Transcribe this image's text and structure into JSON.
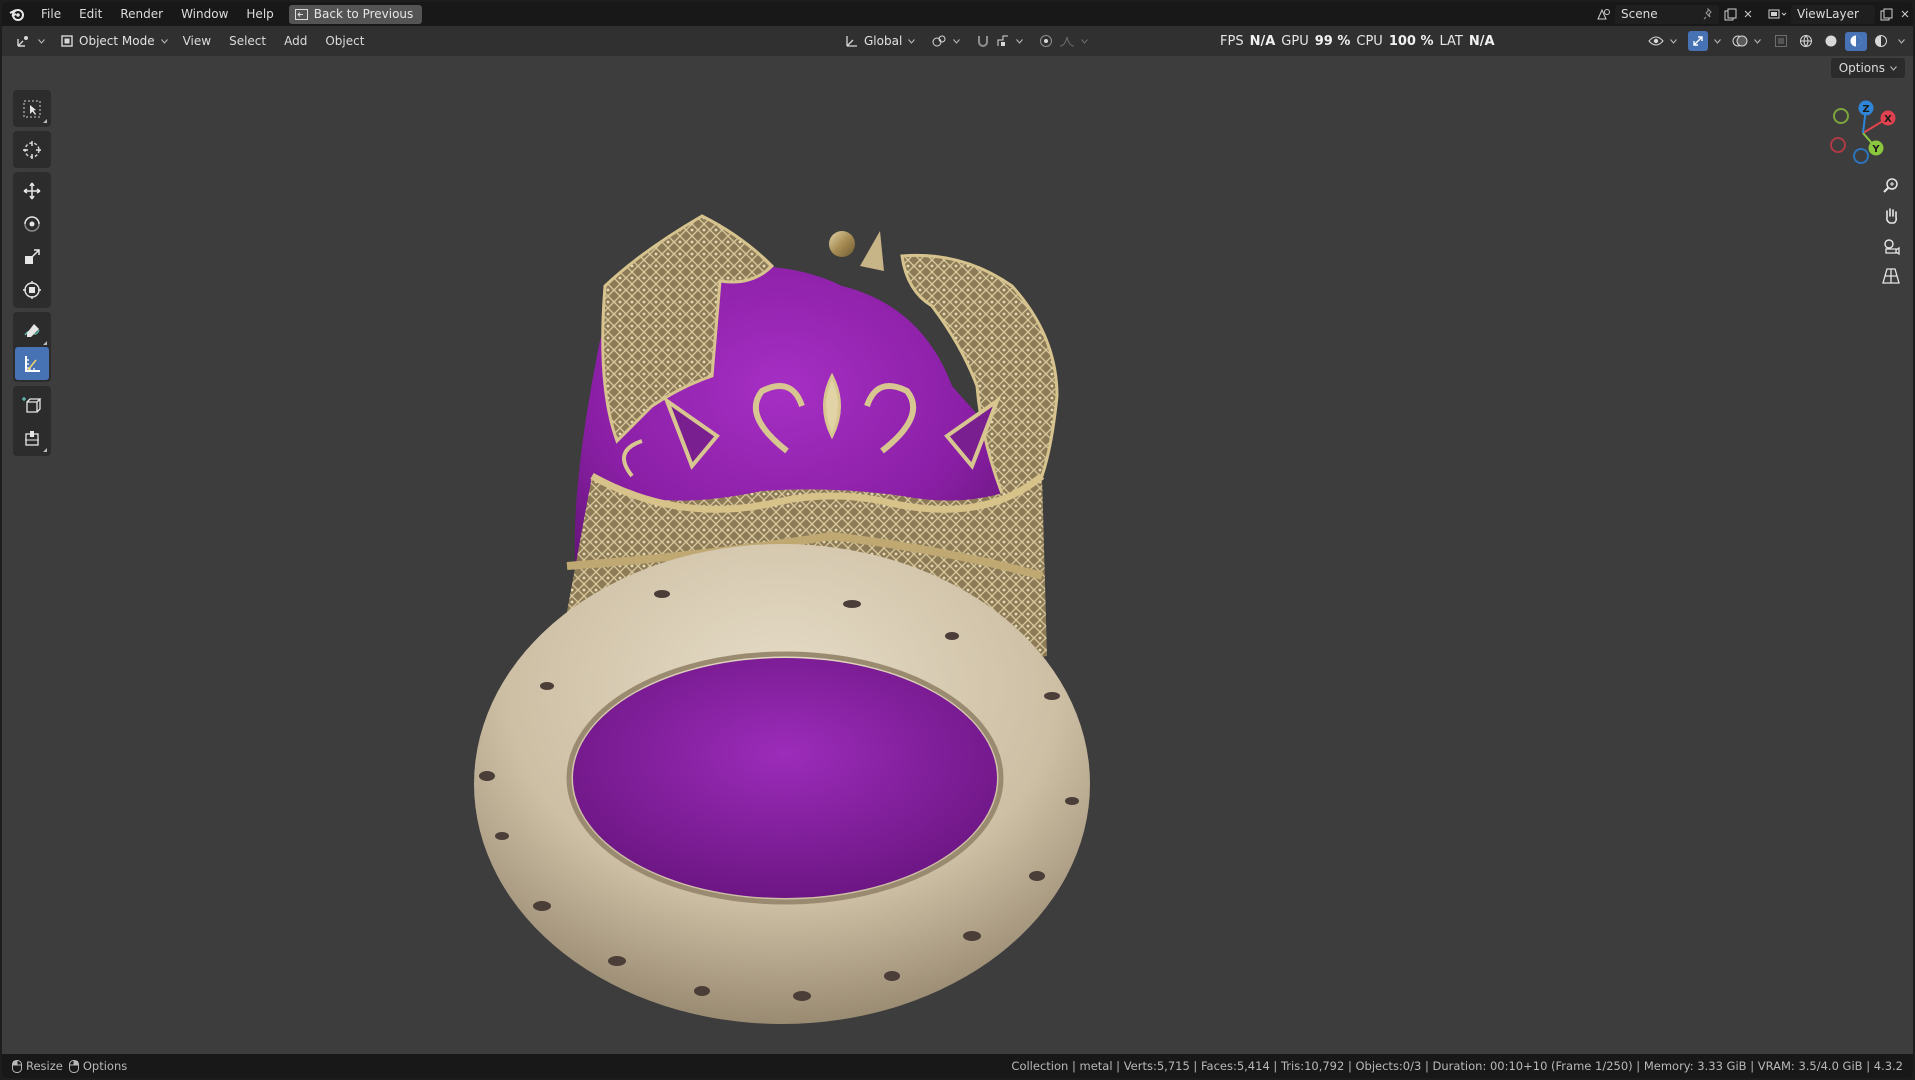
{
  "menu": {
    "items": [
      "File",
      "Edit",
      "Render",
      "Window",
      "Help"
    ],
    "back_button": "Back to Previous"
  },
  "topbar_right": {
    "scene_name": "Scene",
    "view_layer": "ViewLayer"
  },
  "viewport_header": {
    "mode": "Object Mode",
    "menus": [
      "View",
      "Select",
      "Add",
      "Object"
    ],
    "orientation": "Global",
    "options": "Options"
  },
  "stats": {
    "fps_label": "FPS",
    "fps_value": "N/A",
    "gpu_label": "GPU",
    "gpu_value": "99 %",
    "cpu_label": "CPU",
    "cpu_value": "100 %",
    "lat_label": "LAT",
    "lat_value": "N/A"
  },
  "gizmo": {
    "x": "X",
    "y": "Y",
    "z": "Z"
  },
  "statusbar": {
    "resize": "Resize",
    "options": "Options",
    "info": "Collection | metal | Verts:5,715 | Faces:5,414 | Tris:10,792 | Objects:0/3 | Duration: 00:10+10 (Frame 1/250) | Memory: 3.33 GiB | VRAM: 3.5/4.0 GiB | 4.3.2"
  },
  "colors": {
    "viewport_bg": "#3d3d3d",
    "header_bg": "#303030",
    "accent": "#4772b3",
    "velvet": "#8a1fa5",
    "gold": "#b59a62",
    "fur": "#d2c5ad"
  },
  "icons": {
    "app": "blender-logo-icon",
    "tools": [
      "select-box-icon",
      "cursor-icon",
      "move-icon",
      "rotate-icon",
      "scale-icon",
      "transform-icon",
      "annotate-icon",
      "measure-icon",
      "add-cube-icon",
      "add-object-icon"
    ]
  }
}
